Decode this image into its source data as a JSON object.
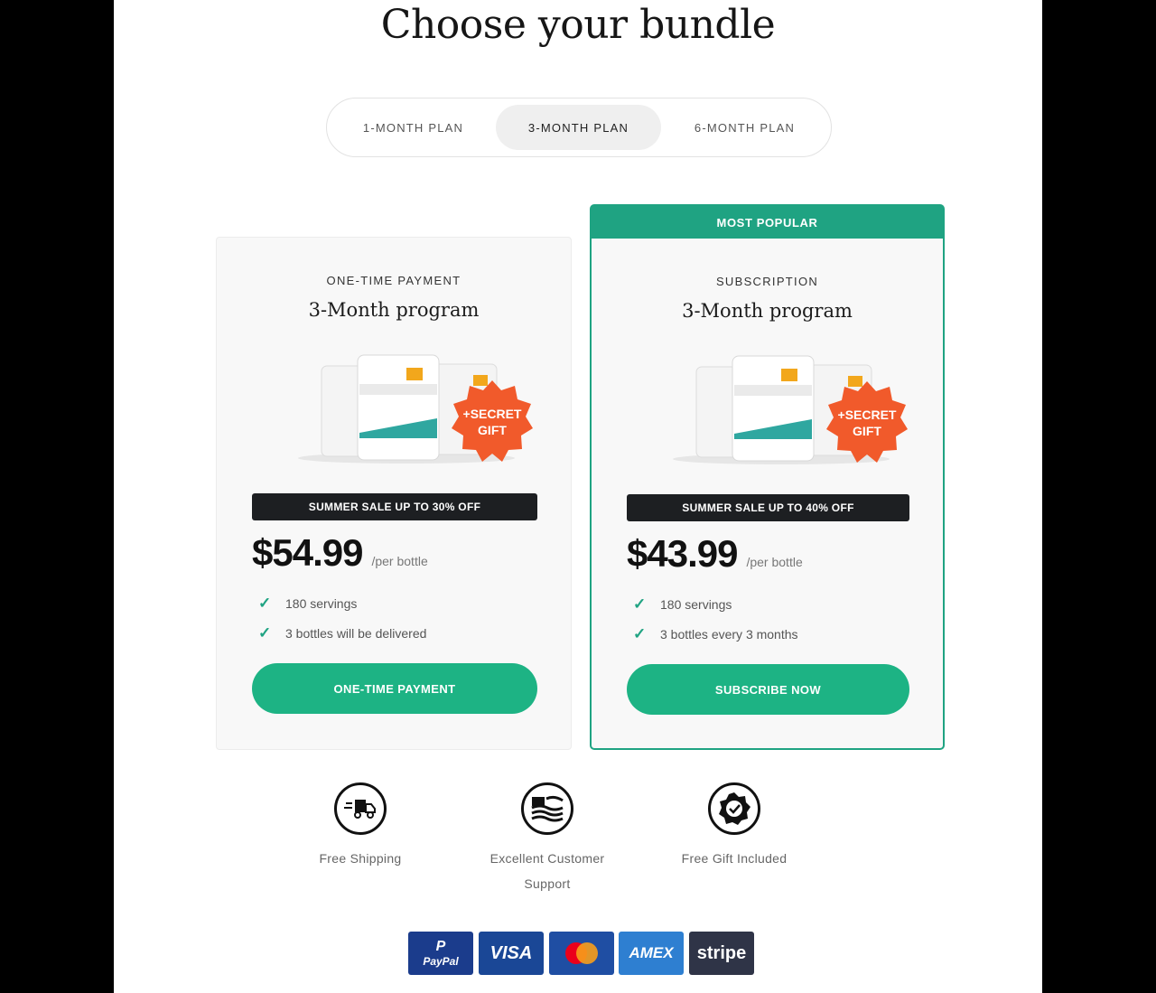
{
  "title": "Choose your bundle",
  "tabs": [
    {
      "label": "1-MONTH PLAN"
    },
    {
      "label": "3-MONTH PLAN"
    },
    {
      "label": "6-MONTH PLAN"
    }
  ],
  "cards": [
    {
      "type_label": "ONE-TIME PAYMENT",
      "name": "3-Month program",
      "gift_badge": "+SECRET GIFT",
      "sale_banner": "SUMMER SALE UP TO 30% OFF",
      "price": "$54.99",
      "price_unit": "/per bottle",
      "features": [
        "180 servings",
        "3 bottles will be delivered"
      ],
      "cta": "ONE-TIME PAYMENT"
    },
    {
      "ribbon": "MOST POPULAR",
      "type_label": "SUBSCRIPTION",
      "name": "3-Month program",
      "gift_badge": "+SECRET GIFT",
      "sale_banner": "SUMMER SALE UP TO 40% OFF",
      "price": "$43.99",
      "price_unit": "/per bottle",
      "features": [
        "180 servings",
        "3 bottles every 3 months"
      ],
      "cta": "SUBSCRIBE NOW"
    }
  ],
  "perks": [
    {
      "label": "Free Shipping",
      "icon": "truck-icon"
    },
    {
      "label": "Excellent Customer Support",
      "icon": "flag-icon"
    },
    {
      "label": "Free Gift Included",
      "icon": "badge-check-icon"
    }
  ],
  "payments": [
    {
      "label": "PayPal",
      "color": "#1b3c8c"
    },
    {
      "label": "VISA",
      "color": "#1a4796"
    },
    {
      "label": "mastercard",
      "color": "#1f4ea3"
    },
    {
      "label": "AMEX",
      "color": "#2e7fd1"
    },
    {
      "label": "stripe",
      "color": "#2f3447"
    }
  ],
  "colors": {
    "accent": "#1db384",
    "accent_border": "#1fa382",
    "gift": "#f15a2b"
  }
}
